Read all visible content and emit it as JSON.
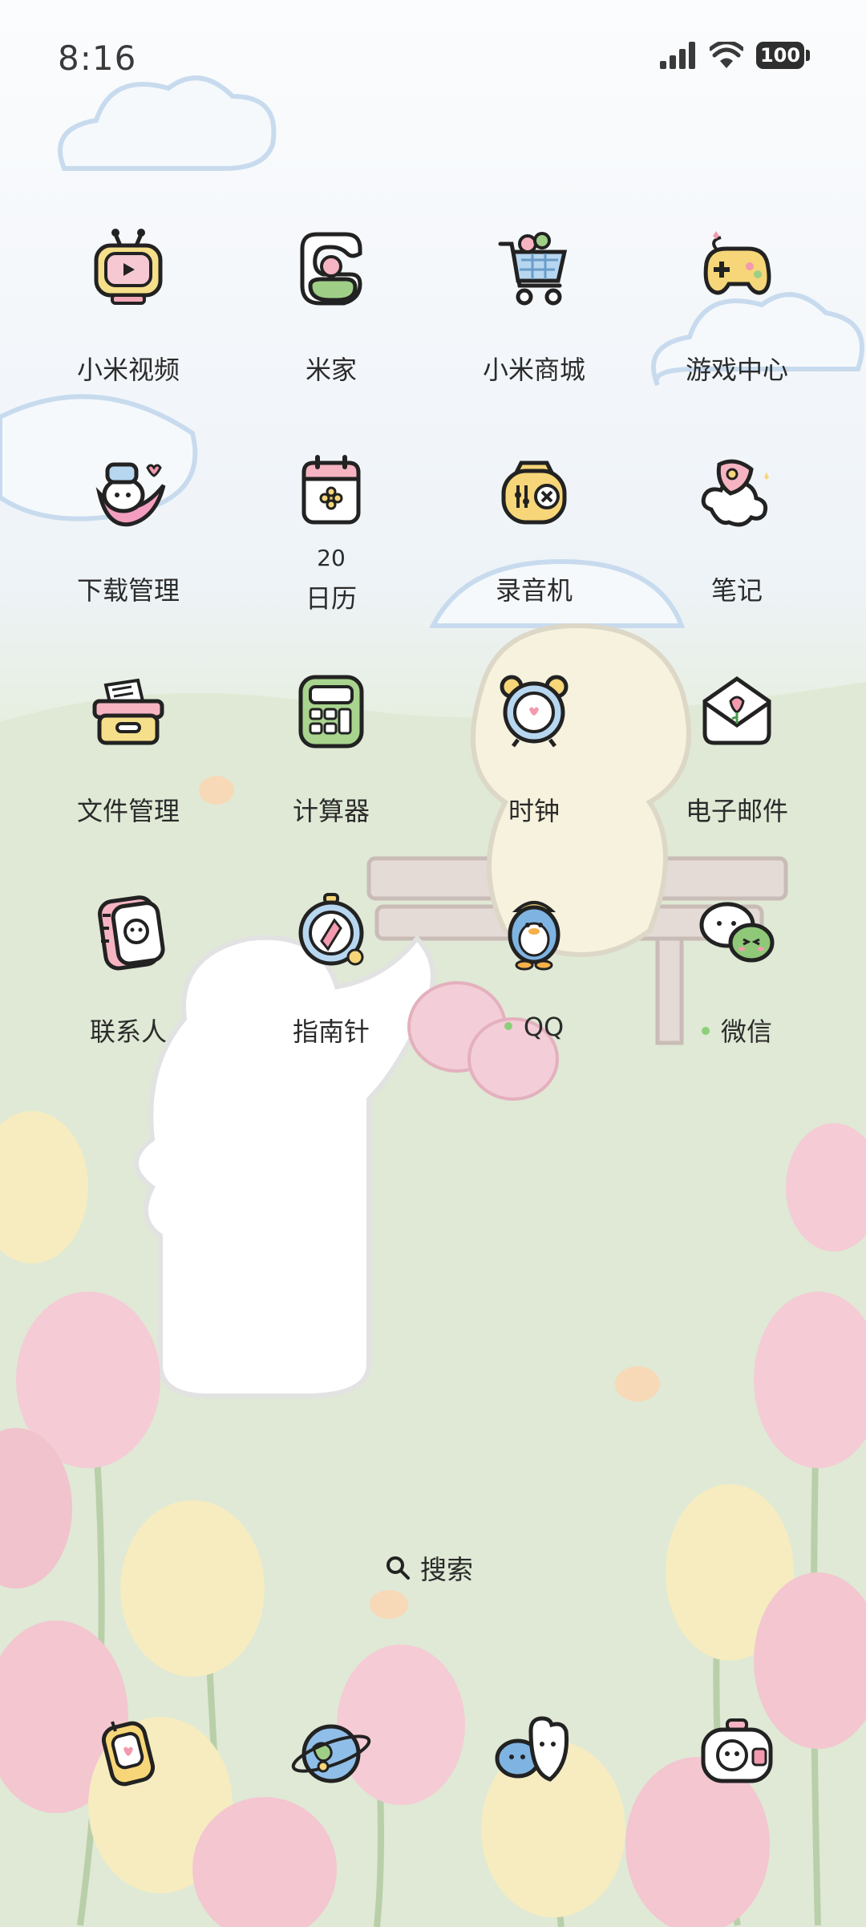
{
  "status_bar": {
    "time": "8:16",
    "battery_level": "100",
    "signal_icon": "cellular-signal-icon",
    "wifi_icon": "wifi-icon"
  },
  "apps": [
    {
      "label": "小米视频",
      "icon": "tv-video-icon"
    },
    {
      "label": "米家",
      "icon": "mijia-home-icon"
    },
    {
      "label": "小米商城",
      "icon": "shopping-cart-icon"
    },
    {
      "label": "游戏中心",
      "icon": "gamepad-icon"
    },
    {
      "label": "下载管理",
      "icon": "download-manager-icon"
    },
    {
      "label": "日历",
      "icon": "calendar-icon",
      "date": "20"
    },
    {
      "label": "录音机",
      "icon": "recorder-icon"
    },
    {
      "label": "笔记",
      "icon": "notes-icon"
    },
    {
      "label": "文件管理",
      "icon": "file-box-icon"
    },
    {
      "label": "计算器",
      "icon": "calculator-icon"
    },
    {
      "label": "时钟",
      "icon": "alarm-clock-icon"
    },
    {
      "label": "电子邮件",
      "icon": "mail-envelope-icon"
    },
    {
      "label": "联系人",
      "icon": "contacts-book-icon"
    },
    {
      "label": "指南针",
      "icon": "compass-icon"
    },
    {
      "label": "QQ",
      "icon": "qq-penguin-icon",
      "new_dot": true
    },
    {
      "label": "微信",
      "icon": "wechat-bubbles-icon",
      "new_dot": true
    }
  ],
  "search": {
    "label": "搜索",
    "icon": "search-icon"
  },
  "dock": [
    {
      "icon": "phone-icon"
    },
    {
      "icon": "browser-planet-icon"
    },
    {
      "icon": "messages-icon"
    },
    {
      "icon": "camera-icon"
    }
  ],
  "colors": {
    "sky": "#e9f1f7",
    "grass": "#dbe6cf",
    "tulip_pink": "#f3c6d0",
    "tulip_yellow": "#f6e7a8",
    "cloud_stroke": "#b9d2ea",
    "new_dot": "#8ccf7a"
  }
}
